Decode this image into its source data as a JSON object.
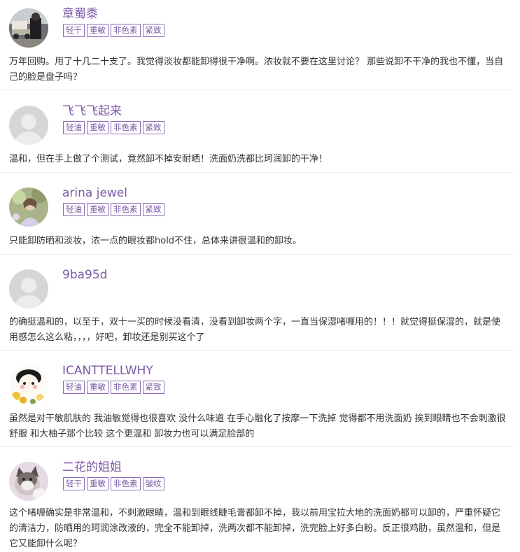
{
  "reviews": [
    {
      "username": "章蜀黍",
      "avatar_icon": "photo-avatar-icon",
      "tags": [
        "轻干",
        "重敏",
        "非色素",
        "紧致"
      ],
      "comment": "万年回购。用了十几二十支了。我觉得淡妆都能卸得很干净啊。浓妆就不要在这里讨论？ 那些说卸不干净的我也不懂，当自己的脸是盘子吗？"
    },
    {
      "username": "飞飞飞起来",
      "avatar_icon": "default-user-icon",
      "tags": [
        "轻油",
        "重敏",
        "非色素",
        "紧致"
      ],
      "comment": "温和，但在手上做了个测试，竟然卸不掉安耐晒！洗面奶洗都比珂润卸的干净！"
    },
    {
      "username": "arina jewel",
      "avatar_icon": "photo-avatar-icon",
      "tags": [
        "轻油",
        "重敏",
        "非色素",
        "紧致"
      ],
      "comment": "只能卸防晒和淡妆，浓一点的眼妆都hold不住，总体来讲很温和的卸妆。"
    },
    {
      "username": "9ba95d",
      "avatar_icon": "default-user-icon",
      "tags": [],
      "comment": "的确挺温和的，以至于，双十一买的时候没看清，没看到卸妆两个字，一直当保湿啫喱用的！！！就觉得挺保湿的，就是使用感怎么这么粘，，，，好吧，卸妆还是别买这个了"
    },
    {
      "username": "ICANTTELLWHY",
      "avatar_icon": "cartoon-avatar-icon",
      "tags": [
        "轻油",
        "重敏",
        "非色素",
        "紧致"
      ],
      "comment": "虽然是对干敏肌肤的 我油敏觉得也很喜欢 没什么味道 在手心融化了按摩一下洗掉 觉得都不用洗面奶 挨到眼睛也不会刺激很舒服 和大柚子那个比较 这个更温和 卸妆力也可以满足脸部的"
    },
    {
      "username": "二花的姐姐",
      "avatar_icon": "cat-avatar-icon",
      "tags": [
        "轻干",
        "重敏",
        "非色素",
        "皱纹"
      ],
      "comment": "这个啫喱确实是非常温和，不刺激眼睛，温和到眼线睫毛膏都卸不掉，我以前用宝拉大地的洗面奶都可以卸的，严重怀疑它的清洁力，防晒用的珂润涂改液的，完全不能卸掉，洗两次都不能卸掉，洗完脸上好多白粉。反正很鸡肋，虽然温和，但是它又能卸什么呢？"
    }
  ]
}
